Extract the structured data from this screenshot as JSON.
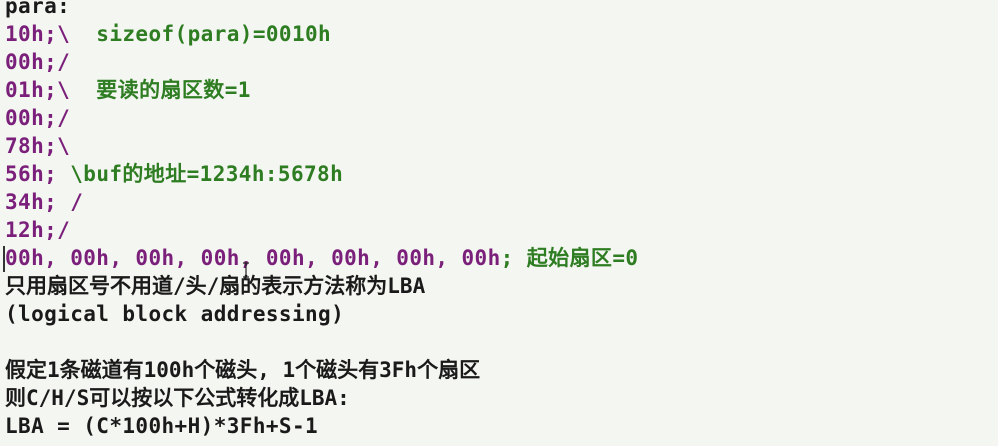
{
  "code": {
    "label": "para:",
    "lines": [
      {
        "addr": "10h;\\",
        "comment": "  sizeof(para)=0010h"
      },
      {
        "addr": "00h;/",
        "comment": ""
      },
      {
        "addr": "01h;\\",
        "comment": "  要读的扇区数=1"
      },
      {
        "addr": "00h;/",
        "comment": ""
      },
      {
        "addr": "78h;\\",
        "comment": ""
      },
      {
        "addr": "56h;",
        "comment": " \\buf的地址=1234h:5678h"
      },
      {
        "addr": "34h;",
        "comment": " /"
      },
      {
        "addr": "12h;/",
        "comment": ""
      }
    ],
    "sector_line": {
      "values": "00h, 00h, 00h, 00h, 00h, 00h, 00h, 00h",
      "comment": "; 起始扇区=0"
    }
  },
  "notes": {
    "lba_line1": "只用扇区号不用道/头/扇的表示方法称为LBA",
    "lba_line2": "(logical block addressing)",
    "blank": "",
    "assume_line": "假定1条磁道有100h个磁头, 1个磁头有3Fh个扇区",
    "convert_line": "则C/H/S可以按以下公式转化成LBA:",
    "formula_line": "LBA = (C*100h+H)*3Fh+S-1"
  },
  "colors": {
    "background": "#f4f6f1",
    "address": "#7a1f7a",
    "comment": "#2e7d22",
    "text": "#1a1a1a"
  }
}
